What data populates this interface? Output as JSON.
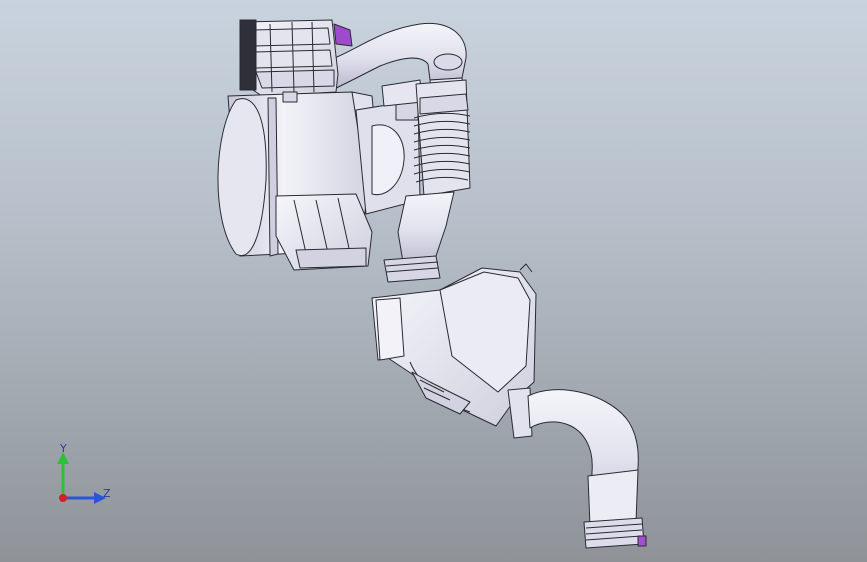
{
  "viewport": {
    "background_top": "#c9d3de",
    "background_bottom": "#8f9398"
  },
  "model": {
    "part_fill": "#ececf4",
    "part_shade": "#c6c6d6",
    "edge_color": "#2a2a33",
    "accent_color": "#a24fd0"
  },
  "triad": {
    "y_label": "Y",
    "z_label": "Z",
    "y_color": "#2fbf3a",
    "z_color": "#2a55d8",
    "origin_color": "#d0202a"
  }
}
